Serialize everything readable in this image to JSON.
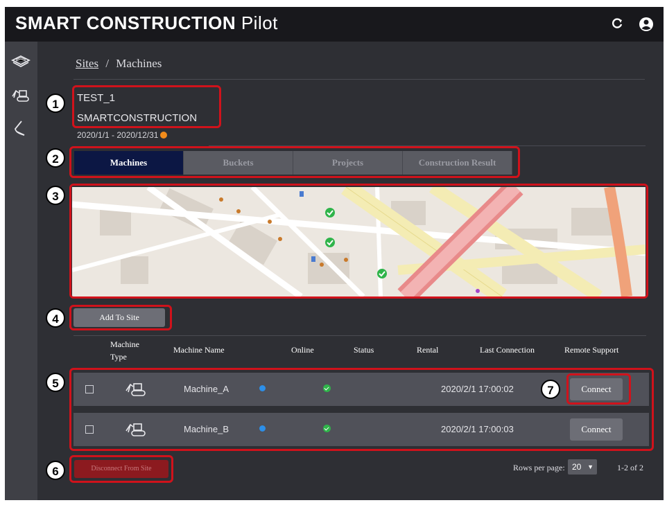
{
  "app": {
    "title_bold": "SMART CONSTRUCTION",
    "title_light": "Pilot"
  },
  "top_icons": [
    "refresh-icon",
    "account-icon"
  ],
  "sidebar": {
    "items": [
      {
        "icon": "layers-icon"
      },
      {
        "icon": "machine-icon"
      },
      {
        "icon": "bucket-icon"
      }
    ]
  },
  "breadcrumb": {
    "sites": "Sites",
    "sep": "/",
    "machines": "Machines"
  },
  "site": {
    "name": "TEST_1",
    "company": "SMARTCONSTRUCTION",
    "dates": "2020/1/1 - 2020/12/31",
    "status_color": "#f28c1b"
  },
  "tabs": [
    {
      "label": "Machines",
      "active": true
    },
    {
      "label": "Buckets",
      "active": false
    },
    {
      "label": "Projects",
      "active": false
    },
    {
      "label": "Construction Result",
      "active": false
    }
  ],
  "add_button": "Add To Site",
  "table": {
    "headers": {
      "machine_type_1": "Machine",
      "machine_type_2": "Type",
      "machine_name": "Machine Name",
      "online": "Online",
      "status": "Status",
      "rental": "Rental",
      "last_connection": "Last Connection",
      "remote_support": "Remote Support"
    },
    "rows": [
      {
        "name": "Machine_A",
        "online": "blue",
        "status": "green-check",
        "last_connection": "2020/2/1 17:00:02",
        "action": "Connect"
      },
      {
        "name": "Machine_B",
        "online": "blue",
        "status": "green-check",
        "last_connection": "2020/2/1 17:00:03",
        "action": "Connect"
      }
    ]
  },
  "footer": {
    "disconnect": "Disconnect From Site",
    "rows_per_page_label": "Rows per page:",
    "rows_per_page_value": "20",
    "range": "1-2 of 2"
  },
  "callouts": [
    "1",
    "2",
    "3",
    "4",
    "5",
    "6",
    "7"
  ],
  "colors": {
    "accent_red": "#d0121b",
    "active_tab": "#0c1744",
    "online_blue": "#2d8fe8",
    "status_green": "#2fb44a",
    "disconnect_red": "#8c1a1f"
  }
}
